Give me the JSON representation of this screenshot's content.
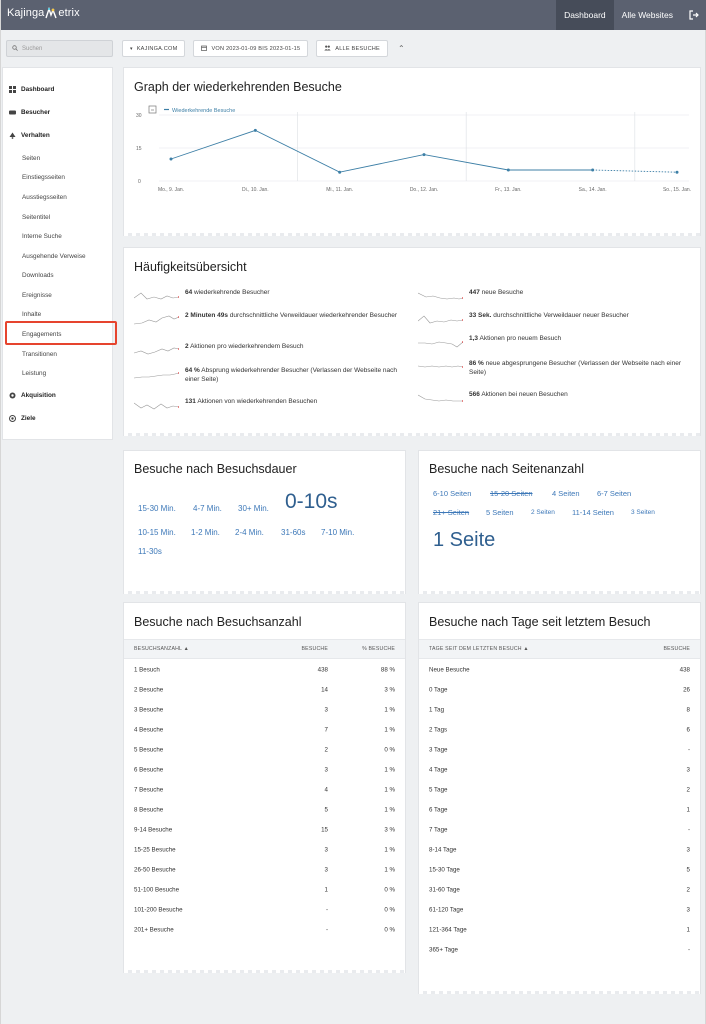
{
  "brand": {
    "name_part1": "Kajinga",
    "name_part2": "etrix"
  },
  "topnav": {
    "dashboard": "Dashboard",
    "all_websites": "Alle Websites"
  },
  "search": {
    "placeholder": "Suchen"
  },
  "filters": {
    "site": "KAJINGA.COM",
    "period": "VON 2023-01-09 BIS 2023-01-15",
    "segment": "ALLE BESUCHE"
  },
  "sidebar": {
    "items": [
      {
        "label": "Dashboard",
        "type": "section",
        "icon": "dashboard-icon"
      },
      {
        "label": "Besucher",
        "type": "section",
        "icon": "visitors-icon"
      },
      {
        "label": "Verhalten",
        "type": "section",
        "icon": "behavior-icon"
      },
      {
        "label": "Seiten",
        "type": "sub"
      },
      {
        "label": "Einstiegsseiten",
        "type": "sub"
      },
      {
        "label": "Ausstiegsseiten",
        "type": "sub"
      },
      {
        "label": "Seitentitel",
        "type": "sub"
      },
      {
        "label": "Interne Suche",
        "type": "sub"
      },
      {
        "label": "Ausgehende Verweise",
        "type": "sub"
      },
      {
        "label": "Downloads",
        "type": "sub"
      },
      {
        "label": "Ereignisse",
        "type": "sub"
      },
      {
        "label": "Inhalte",
        "type": "sub"
      },
      {
        "label": "Engagements",
        "type": "sub",
        "active": true
      },
      {
        "label": "Transitionen",
        "type": "sub"
      },
      {
        "label": "Leistung",
        "type": "sub"
      },
      {
        "label": "Akquisition",
        "type": "section",
        "icon": "acquisition-icon"
      },
      {
        "label": "Ziele",
        "type": "section",
        "icon": "goals-icon"
      }
    ]
  },
  "graph": {
    "title": "Graph der wiederkehrenden Besuche",
    "legend": "Wiederkehrende Besuche",
    "color": "#3d7fa6",
    "chart_data": {
      "type": "line",
      "categories": [
        "Mo., 9. Jan.",
        "Di., 10. Jan.",
        "Mi., 11. Jan.",
        "Do., 12. Jan.",
        "Fr., 13. Jan.",
        "Sa., 14. Jan.",
        "So., 15. Jan."
      ],
      "series": [
        {
          "name": "Wiederkehrende Besuche",
          "values": [
            10,
            23,
            4,
            12,
            5,
            5,
            4
          ]
        }
      ],
      "yticks": [
        "30",
        "15",
        "0"
      ],
      "ylim": [
        0,
        30
      ]
    }
  },
  "overview": {
    "title": "Häufigkeitsübersicht",
    "left": [
      {
        "value": "64",
        "text": "wiederkehrende Besucher"
      },
      {
        "value": "2 Minuten 49s",
        "text": "durchschnittliche Verweildauer wiederkehrender Besucher"
      },
      {
        "value": "2",
        "text": "Aktionen pro wiederkehrendem Besuch"
      },
      {
        "value": "64 %",
        "text": "Absprung wiederkehrender Besucher (Verlassen der Webseite nach einer Seite)"
      },
      {
        "value": "131",
        "text": "Aktionen von wiederkehrenden Besuchen"
      }
    ],
    "right": [
      {
        "value": "447",
        "text": "neue Besuche"
      },
      {
        "value": "33 Sek.",
        "text": "durchschnittliche Verweildauer neuer Besucher"
      },
      {
        "value": "1,3",
        "text": "Aktionen pro neuem Besuch"
      },
      {
        "value": "86 %",
        "text": "neue abgesprungene Besucher (Verlassen der Webseite nach einer Seite)"
      },
      {
        "value": "566",
        "text": "Aktionen bei neuen Besuchen"
      }
    ]
  },
  "duration": {
    "title": "Besuche nach Besuchsdauer",
    "tags": [
      "15-30 Min.",
      "4-7 Min.",
      "30+ Min.",
      "0-10s",
      "10-15 Min.",
      "1-2 Min.",
      "2-4 Min.",
      "31-60s",
      "7-10 Min.",
      "11-30s"
    ]
  },
  "pages": {
    "title": "Besuche nach Seitenanzahl",
    "tags": [
      "6-10 Seiten",
      "15-20 Seiten",
      "4 Seiten",
      "6-7 Seiten",
      "21+ Seiten",
      "5 Seiten",
      "2 Seiten",
      "11-14 Seiten",
      "3 Seiten",
      "1 Seite"
    ]
  },
  "count_table": {
    "title": "Besuche nach Besuchsanzahl",
    "headers": [
      "BESUCHSANZAHL ▲",
      "BESUCHE",
      "% BESUCHE"
    ],
    "rows": [
      [
        "1 Besuch",
        "438",
        "88 %"
      ],
      [
        "2 Besuche",
        "14",
        "3 %"
      ],
      [
        "3 Besuche",
        "3",
        "1 %"
      ],
      [
        "4 Besuche",
        "7",
        "1 %"
      ],
      [
        "5 Besuche",
        "2",
        "0 %"
      ],
      [
        "6 Besuche",
        "3",
        "1 %"
      ],
      [
        "7 Besuche",
        "4",
        "1 %"
      ],
      [
        "8 Besuche",
        "5",
        "1 %"
      ],
      [
        "9-14 Besuche",
        "15",
        "3 %"
      ],
      [
        "15-25 Besuche",
        "3",
        "1 %"
      ],
      [
        "26-50 Besuche",
        "3",
        "1 %"
      ],
      [
        "51-100 Besuche",
        "1",
        "0 %"
      ],
      [
        "101-200 Besuche",
        "-",
        "0 %"
      ],
      [
        "201+ Besuche",
        "-",
        "0 %"
      ]
    ]
  },
  "days_table": {
    "title": "Besuche nach Tage seit letztem Besuch",
    "headers": [
      "TAGE SEIT DEM LETZTEN BESUCH ▲",
      "BESUCHE"
    ],
    "rows": [
      [
        "Neue Besuche",
        "438"
      ],
      [
        "0 Tage",
        "26"
      ],
      [
        "1 Tag",
        "8"
      ],
      [
        "2 Tags",
        "6"
      ],
      [
        "3 Tage",
        "-"
      ],
      [
        "4 Tage",
        "3"
      ],
      [
        "5 Tage",
        "2"
      ],
      [
        "6 Tage",
        "1"
      ],
      [
        "7 Tage",
        "-"
      ],
      [
        "8-14 Tage",
        "3"
      ],
      [
        "15-30 Tage",
        "5"
      ],
      [
        "31-60 Tage",
        "2"
      ],
      [
        "61-120 Tage",
        "3"
      ],
      [
        "121-364 Tage",
        "1"
      ],
      [
        "365+ Tage",
        "-"
      ]
    ]
  }
}
